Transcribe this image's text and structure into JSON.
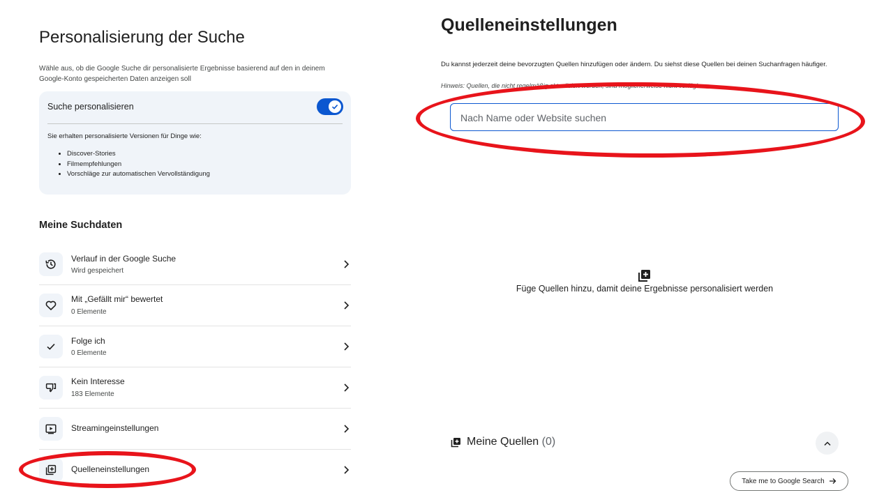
{
  "personalization": {
    "title": "Personalisierung der Suche",
    "description": "Wähle aus, ob die Google Suche dir personalisierte Ergebnisse basierend auf den in deinem Google-Konto gespeicherten Daten anzeigen soll",
    "toggle_label": "Suche personalisieren",
    "toggle_on": true,
    "benefits_intro": "Sie erhalten personalisierte Versionen für Dinge wie:",
    "benefits": [
      "Discover-Stories",
      "Filmempfehlungen",
      "Vorschläge zur automatischen Vervollständigung"
    ]
  },
  "search_data": {
    "title": "Meine Suchdaten",
    "items": [
      {
        "title": "Verlauf in der Google Suche",
        "subtitle": "Wird gespeichert",
        "icon": "history-icon"
      },
      {
        "title": "Mit „Gefällt mir“ bewertet",
        "subtitle": "0 Elemente",
        "icon": "heart-icon"
      },
      {
        "title": "Folge ich",
        "subtitle": "0 Elemente",
        "icon": "checkmark-icon"
      },
      {
        "title": "Kein Interesse",
        "subtitle": "183 Elemente",
        "icon": "thumbs-down-icon"
      },
      {
        "title": "Streamingeinstellungen",
        "subtitle": "",
        "icon": "play-video-icon"
      },
      {
        "title": "Quelleneinstellungen",
        "subtitle": "",
        "icon": "sources-icon"
      }
    ]
  },
  "sources": {
    "title": "Quelleneinstellungen",
    "description": "Du kannst jederzeit deine bevorzugten Quellen hinzufügen oder ändern. Du siehst diese Quellen bei deinen Suchanfragen häufiger.",
    "note": "Hinweis: Quellen, die nicht regelmäßig aktualisiert werden, sind möglicherweise nicht verfügbar.",
    "search_placeholder": "Nach Name oder Website suchen",
    "empty_message": "Füge Quellen hinzu, damit deine Ergebnisse personalisiert werden",
    "my_sources_label": "Meine Quellen",
    "my_sources_count": "(0)",
    "take_me_label": "Take me to Google Search"
  },
  "colors": {
    "accent": "#0b57d0",
    "card_bg": "#f0f4f9",
    "annotation": "#e8141b"
  }
}
